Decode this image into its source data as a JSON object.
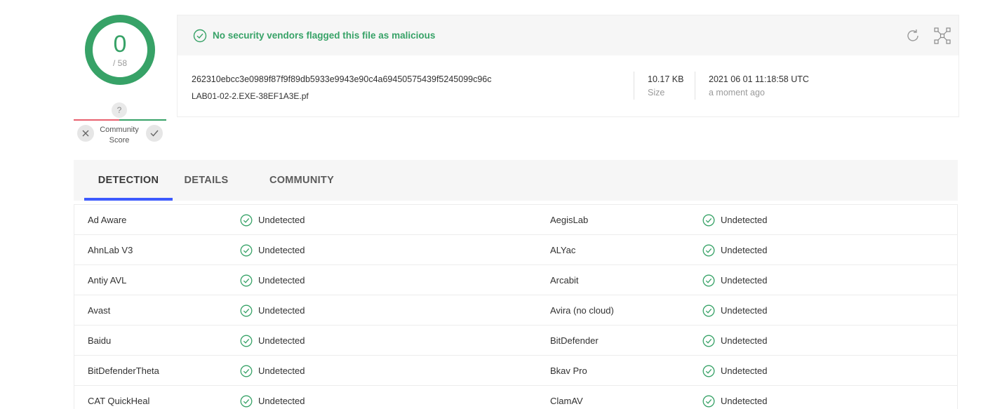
{
  "score": {
    "detections": "0",
    "total": "/ 58"
  },
  "community": {
    "unknown": "?",
    "label_line1": "Community",
    "label_line2": "Score"
  },
  "summary": {
    "status_text": "No security vendors flagged this file as malicious",
    "hash": "262310ebcc3e0989f87f9f89db5933e9943e90c4a69450575439f5245099c96c",
    "filename": "LAB01-02-2.EXE-38EF1A3E.pf",
    "size_value": "10.17 KB",
    "size_label": "Size",
    "date_value": "2021 06 01 11:18:58 UTC",
    "date_relative": "a moment ago"
  },
  "tabs": [
    {
      "label": "DETECTION",
      "active": true
    },
    {
      "label": "DETAILS",
      "active": false
    },
    {
      "label": "COMMUNITY",
      "active": false
    }
  ],
  "detections": [
    {
      "left_engine": "Ad Aware",
      "left_result": "Undetected",
      "right_engine": "AegisLab",
      "right_result": "Undetected"
    },
    {
      "left_engine": "AhnLab V3",
      "left_result": "Undetected",
      "right_engine": "ALYac",
      "right_result": "Undetected"
    },
    {
      "left_engine": "Antiy AVL",
      "left_result": "Undetected",
      "right_engine": "Arcabit",
      "right_result": "Undetected"
    },
    {
      "left_engine": "Avast",
      "left_result": "Undetected",
      "right_engine": "Avira (no cloud)",
      "right_result": "Undetected"
    },
    {
      "left_engine": "Baidu",
      "left_result": "Undetected",
      "right_engine": "BitDefender",
      "right_result": "Undetected"
    },
    {
      "left_engine": "BitDefenderTheta",
      "left_result": "Undetected",
      "right_engine": "Bkav Pro",
      "right_result": "Undetected"
    },
    {
      "left_engine": "CAT QuickHeal",
      "left_result": "Undetected",
      "right_engine": "ClamAV",
      "right_result": "Undetected"
    }
  ],
  "colors": {
    "clean": "#37a267",
    "malicious": "#e8606e",
    "accent": "#3d5afe"
  },
  "icons": [
    "check-circle-icon",
    "refresh-icon",
    "graph-icon",
    "close-icon",
    "check-icon"
  ]
}
